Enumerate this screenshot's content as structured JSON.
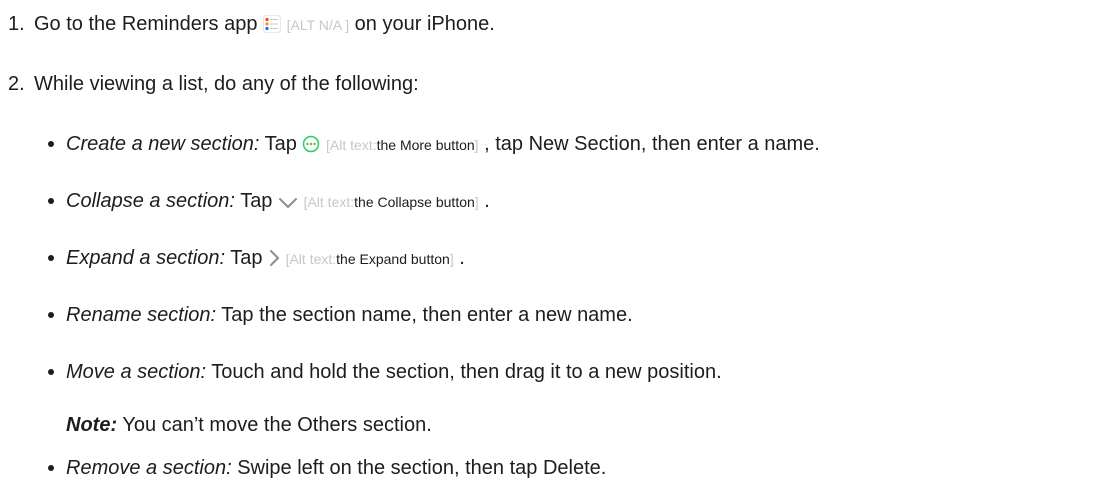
{
  "steps": [
    {
      "number": "1.",
      "before": "Go to the Reminders app",
      "alt": "[ALT N/A ]",
      "after": "on your iPhone."
    },
    {
      "number": "2.",
      "text": "While viewing a list, do any of the following:"
    }
  ],
  "bullets": [
    {
      "term": "Create a new section:",
      "before": "Tap",
      "icon": "more-circle-icon",
      "alt_open": "[Alt text:",
      "alt_text": "the More button",
      "alt_close": "]",
      "after": ", tap New Section, then enter a name."
    },
    {
      "term": "Collapse a section:",
      "before": "Tap",
      "icon": "chevron-down-icon",
      "alt_open": "[Alt text:",
      "alt_text": "the Collapse button",
      "alt_close": "]",
      "after": "."
    },
    {
      "term": "Expand a section:",
      "before": "Tap",
      "icon": "chevron-right-icon",
      "alt_open": "[Alt text:",
      "alt_text": "the Expand button",
      "alt_close": "]",
      "after": "."
    },
    {
      "term": "Rename section:",
      "text": "Tap the section name, then enter a new name."
    },
    {
      "term": "Move a section:",
      "text": "Touch and hold the section, then drag it to a new position."
    },
    {
      "term": "Remove a section:",
      "text": "Swipe left on the section, then tap Delete."
    }
  ],
  "note": {
    "label": "Note:",
    "text": "You can’t move the Others section."
  },
  "colors": {
    "text": "#1d1d1f",
    "alt_faded": "#c7c7cc",
    "icon_gray": "#8e8e93",
    "icon_green": "#34c759",
    "reminder_red": "#ff3b30",
    "reminder_orange": "#ff9500",
    "reminder_blue": "#007aff"
  }
}
